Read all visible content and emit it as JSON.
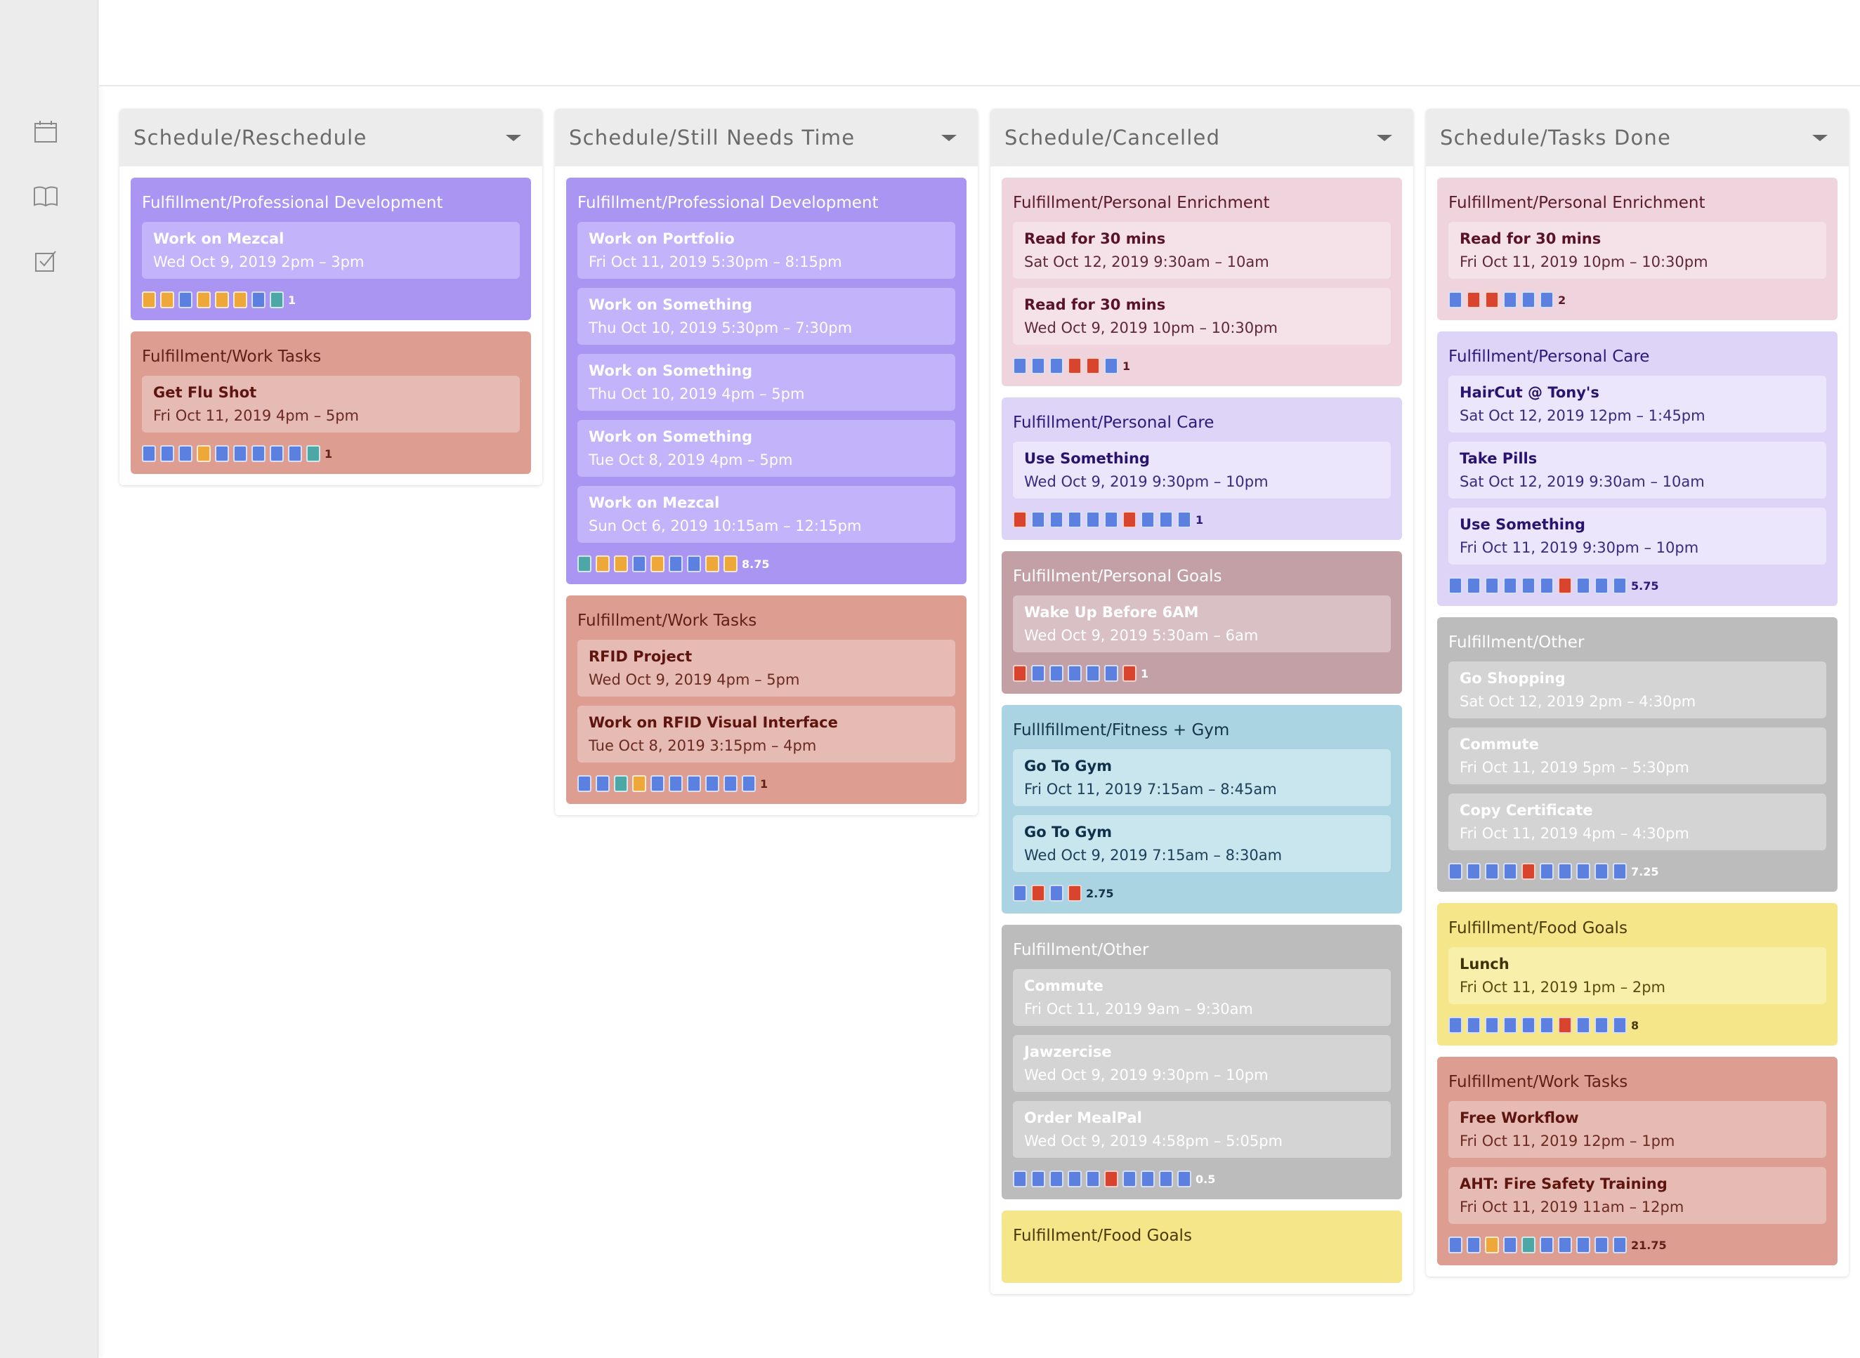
{
  "colors": {
    "sq_blue": "#5b80e0",
    "sq_orange": "#eea839",
    "sq_red": "#d9442f",
    "sq_teal": "#4ea7a7"
  },
  "sidebar": {
    "icons": [
      "calendar-icon",
      "book-icon",
      "checkbox-icon"
    ]
  },
  "columns": [
    {
      "title": "Schedule/Reschedule",
      "groups": [
        {
          "title": "Fulfillment/Professional Development",
          "theme": "purple",
          "tasks": [
            {
              "name": "Work on Mezcal",
              "time": "Wed Oct 9, 2019 2pm – 3pm"
            }
          ],
          "squares": [
            "o",
            "o",
            "b",
            "o",
            "o",
            "o",
            "b",
            "t"
          ],
          "value": "1"
        },
        {
          "title": "Fulfillment/Work Tasks",
          "theme": "salmon",
          "tasks": [
            {
              "name": "Get Flu Shot",
              "time": "Fri Oct 11, 2019 4pm – 5pm"
            }
          ],
          "squares": [
            "b",
            "b",
            "b",
            "o",
            "b",
            "b",
            "b",
            "b",
            "b",
            "t"
          ],
          "value": "1"
        }
      ]
    },
    {
      "title": "Schedule/Still Needs Time",
      "groups": [
        {
          "title": "Fulfillment/Professional Development",
          "theme": "purple",
          "tasks": [
            {
              "name": "Work on Portfolio",
              "time": "Fri Oct 11, 2019 5:30pm – 8:15pm"
            },
            {
              "name": "Work on Something",
              "time": "Thu Oct 10, 2019 5:30pm – 7:30pm"
            },
            {
              "name": "Work on Something",
              "time": "Thu Oct 10, 2019 4pm – 5pm"
            },
            {
              "name": "Work on Something",
              "time": "Tue Oct 8, 2019 4pm – 5pm"
            },
            {
              "name": "Work on Mezcal",
              "time": "Sun Oct 6, 2019 10:15am – 12:15pm"
            }
          ],
          "squares": [
            "t",
            "o",
            "o",
            "b",
            "o",
            "b",
            "b",
            "o",
            "o"
          ],
          "value": "8.75"
        },
        {
          "title": "Fulfillment/Work Tasks",
          "theme": "salmon",
          "tasks": [
            {
              "name": "RFID Project",
              "time": "Wed Oct 9, 2019 4pm – 5pm"
            },
            {
              "name": "Work on RFID Visual Interface",
              "time": "Tue Oct 8, 2019 3:15pm – 4pm"
            }
          ],
          "squares": [
            "b",
            "b",
            "t",
            "o",
            "b",
            "b",
            "b",
            "b",
            "b",
            "b"
          ],
          "value": "1"
        }
      ]
    },
    {
      "title": "Schedule/Cancelled",
      "groups": [
        {
          "title": "Fulfillment/Personal Enrichment",
          "theme": "pink",
          "tasks": [
            {
              "name": "Read for 30 mins",
              "time": "Sat Oct 12, 2019 9:30am – 10am"
            },
            {
              "name": "Read for 30 mins",
              "time": "Wed Oct 9, 2019 10pm – 10:30pm"
            }
          ],
          "squares": [
            "b",
            "b",
            "b",
            "r",
            "r",
            "b"
          ],
          "value": "1"
        },
        {
          "title": "Fulfillment/Personal Care",
          "theme": "lavender",
          "tasks": [
            {
              "name": "Use Something",
              "time": "Wed Oct 9, 2019 9:30pm – 10pm"
            }
          ],
          "squares": [
            "r",
            "b",
            "b",
            "b",
            "b",
            "b",
            "r",
            "b",
            "b",
            "b"
          ],
          "value": "1"
        },
        {
          "title": "Fulfillment/Personal Goals",
          "theme": "mauve",
          "tasks": [
            {
              "name": "Wake Up Before 6AM",
              "time": "Wed Oct 9, 2019 5:30am – 6am"
            }
          ],
          "squares": [
            "r",
            "b",
            "b",
            "b",
            "b",
            "b",
            "r"
          ],
          "value": "1"
        },
        {
          "title": "Fulllfillment/Fitness + Gym",
          "theme": "blue",
          "tasks": [
            {
              "name": "Go To Gym",
              "time": "Fri Oct 11, 2019 7:15am – 8:45am"
            },
            {
              "name": "Go To Gym",
              "time": "Wed Oct 9, 2019 7:15am – 8:30am"
            }
          ],
          "squares": [
            "b",
            "r",
            "b",
            "r"
          ],
          "value": "2.75"
        },
        {
          "title": "Fulfillment/Other",
          "theme": "gray",
          "tasks": [
            {
              "name": "Commute",
              "time": "Fri Oct 11, 2019 9am – 9:30am"
            },
            {
              "name": "Jawzercise",
              "time": "Wed Oct 9, 2019 9:30pm – 10pm"
            },
            {
              "name": "Order MealPal",
              "time": "Wed Oct 9, 2019 4:58pm – 5:05pm"
            }
          ],
          "squares": [
            "b",
            "b",
            "b",
            "b",
            "b",
            "r",
            "b",
            "b",
            "b",
            "b"
          ],
          "value": "0.5"
        },
        {
          "title": "Fulfillment/Food Goals",
          "theme": "yellow",
          "tasks": [],
          "squares": [],
          "value": ""
        }
      ]
    },
    {
      "title": "Schedule/Tasks Done",
      "groups": [
        {
          "title": "Fulfillment/Personal Enrichment",
          "theme": "pink",
          "tasks": [
            {
              "name": "Read for 30 mins",
              "time": "Fri Oct 11, 2019 10pm – 10:30pm"
            }
          ],
          "squares": [
            "b",
            "r",
            "r",
            "b",
            "b",
            "b"
          ],
          "value": "2"
        },
        {
          "title": "Fulfillment/Personal Care",
          "theme": "lavender",
          "tasks": [
            {
              "name": "HairCut @ Tony's",
              "time": "Sat Oct 12, 2019 12pm – 1:45pm"
            },
            {
              "name": "Take Pills",
              "time": "Sat Oct 12, 2019 9:30am – 10am"
            },
            {
              "name": "Use Something",
              "time": "Fri Oct 11, 2019 9:30pm – 10pm"
            }
          ],
          "squares": [
            "b",
            "b",
            "b",
            "b",
            "b",
            "b",
            "r",
            "b",
            "b",
            "b"
          ],
          "value": "5.75"
        },
        {
          "title": "Fulfillment/Other",
          "theme": "gray",
          "tasks": [
            {
              "name": "Go Shopping",
              "time": "Sat Oct 12, 2019 2pm – 4:30pm"
            },
            {
              "name": "Commute",
              "time": "Fri Oct 11, 2019 5pm – 5:30pm"
            },
            {
              "name": "Copy Certificate",
              "time": "Fri Oct 11, 2019 4pm – 4:30pm"
            }
          ],
          "squares": [
            "b",
            "b",
            "b",
            "b",
            "r",
            "b",
            "b",
            "b",
            "b",
            "b"
          ],
          "value": "7.25"
        },
        {
          "title": "Fulfillment/Food Goals",
          "theme": "yellow",
          "tasks": [
            {
              "name": "Lunch",
              "time": "Fri Oct 11, 2019 1pm – 2pm"
            }
          ],
          "squares": [
            "b",
            "b",
            "b",
            "b",
            "b",
            "b",
            "r",
            "b",
            "b",
            "b"
          ],
          "value": "8"
        },
        {
          "title": "Fulfillment/Work Tasks",
          "theme": "salmon",
          "tasks": [
            {
              "name": "Free Workflow",
              "time": "Fri Oct 11, 2019 12pm – 1pm"
            },
            {
              "name": "AHT: Fire Safety Training",
              "time": "Fri Oct 11, 2019 11am – 12pm"
            }
          ],
          "squares": [
            "b",
            "b",
            "o",
            "b",
            "t",
            "b",
            "b",
            "b",
            "b",
            "b"
          ],
          "value": "21.75"
        }
      ]
    }
  ]
}
